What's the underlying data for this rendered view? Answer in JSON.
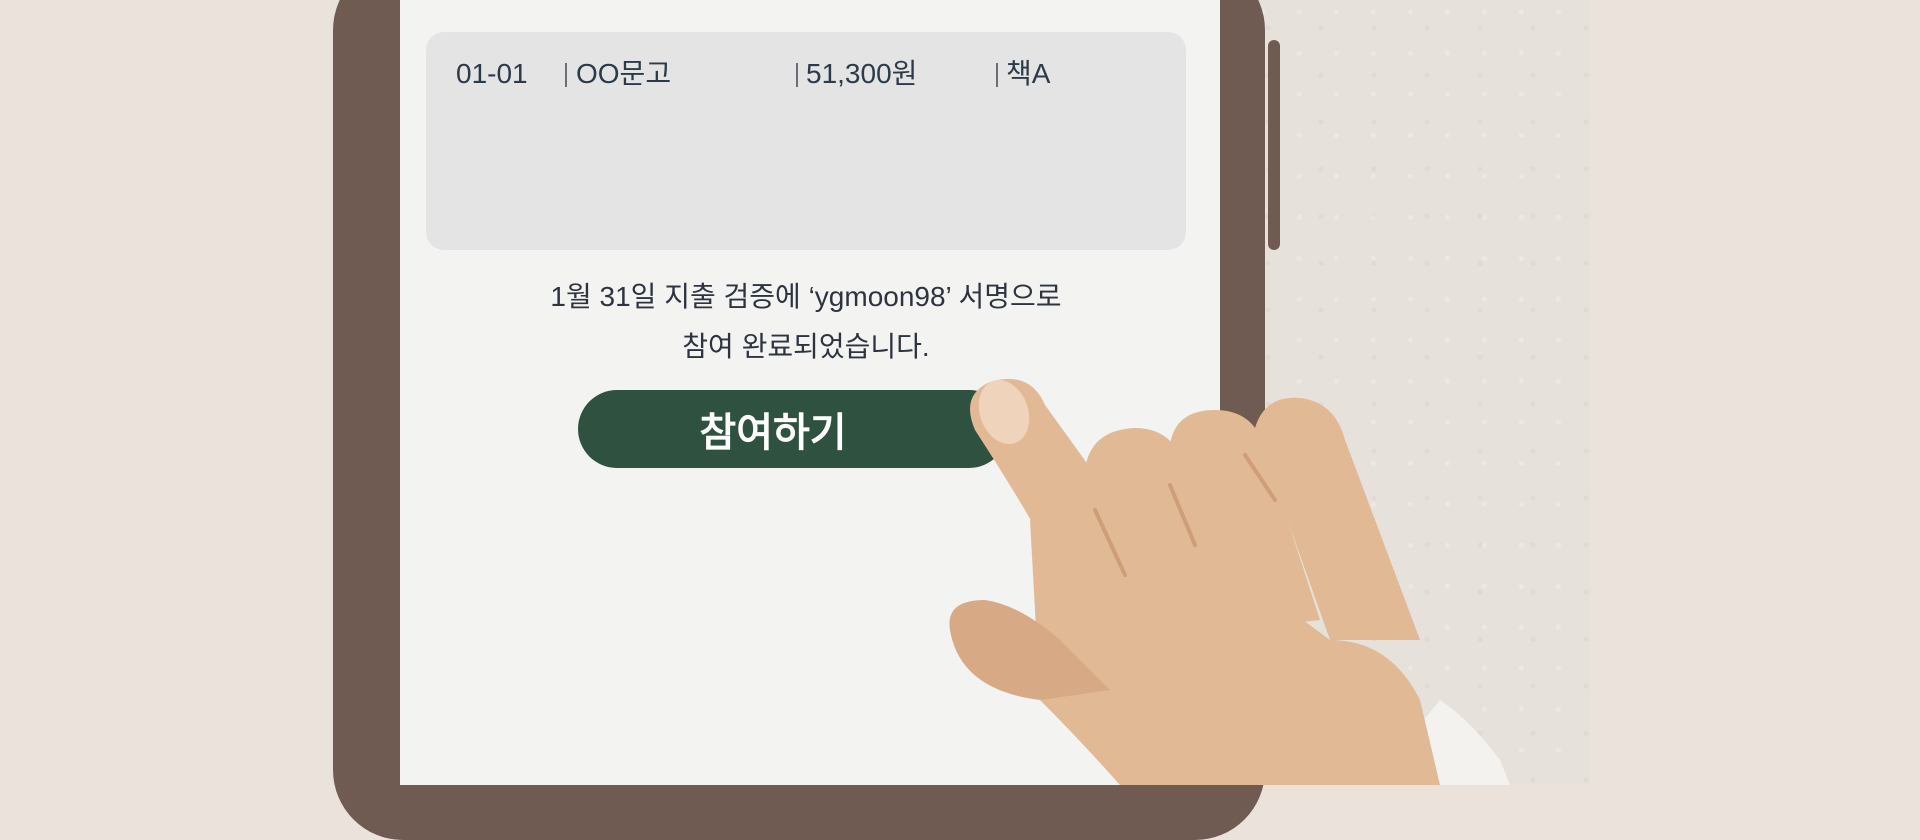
{
  "record": {
    "date": "01-01",
    "vendor": "OO문고",
    "amount": "51,300원",
    "item": "책A"
  },
  "message": {
    "line1": "1월 31일 지출 검증에 ‘ygmoon98’ 서명으로",
    "line2": "참여 완료되었습니다."
  },
  "button": {
    "label": "참여하기"
  },
  "colors": {
    "button": "#2f5240",
    "phone_frame": "#705b53",
    "screen": "#f3f3f2",
    "skin": "#e1b994"
  }
}
